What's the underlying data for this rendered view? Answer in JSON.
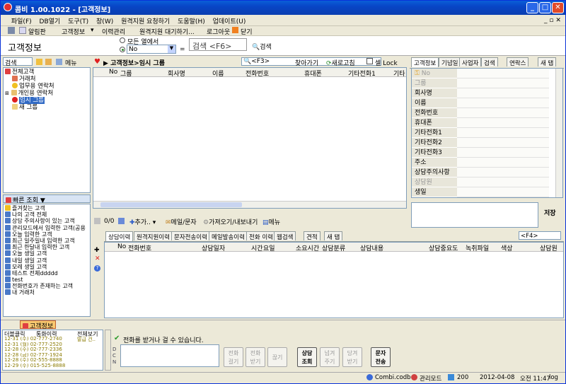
{
  "app": {
    "title": "콤비 1.00.1022 - [고객정보]"
  },
  "menu": [
    "파일(F)",
    "DB열기",
    "도구(T)",
    "창(W)",
    "원격지원 요청하기",
    "도움말(H)",
    "업데이트(U)"
  ],
  "toolbar": {
    "notice": "알림판",
    "customer_info": "고객정보",
    "history": "이력관리",
    "remote_wait": "원격지원 대기하기...",
    "logout": "로그아웃",
    "close": "닫기"
  },
  "header": {
    "title": "고객정보",
    "radio_all": "모든 열에서",
    "radio_no": "No",
    "equals": "=",
    "search_value": "검색 <F6>",
    "search_btn": "검색"
  },
  "left": {
    "search_label": "검색",
    "menu_btn": "메뉴",
    "tree": [
      "전체고객",
      "거래처",
      "업무용 연락처",
      "개인용 연락처",
      "임시 그룹",
      "새 그룹"
    ],
    "quick_title": "빠른 조회 ▼",
    "quick": [
      "즐겨찾는 고객",
      "나의 고객 전체",
      "상담 주의사항이 있는 고객",
      "관리모드에서 입력한 고객(공용",
      "오늘 입력한 고객",
      "최근 일주일내 입력한 고객",
      "최근 한달내 입력한 고객",
      "오늘 생일 고객",
      "내일 생일 고객",
      "모레 생일 고객",
      "테스트 전체ddddd",
      "test",
      "전화번호가 존재하는 고객",
      "내 거래처"
    ]
  },
  "list": {
    "path": "고객정보>임시 그룹",
    "f3": "<F3>",
    "find": "찾아가기",
    "refresh": "새로고침",
    "cell_lock": "셀 Lock",
    "columns": [
      "No",
      "그룹",
      "회사명",
      "이름",
      "전화번호",
      "휴대폰",
      "기타전화1",
      "기타"
    ],
    "count": "0/0",
    "add": "추가..",
    "mail": "메일/문자",
    "import": "가져오기/내보내기",
    "menu": "메뉴"
  },
  "detail": {
    "tabs": [
      "고객정보",
      "기념일",
      "사업자",
      "검색",
      "연락스",
      "새 탭"
    ],
    "fields": [
      "No",
      "그룹",
      "회사명",
      "이름",
      "전화번호",
      "휴대폰",
      "기타전화1",
      "기타전화2",
      "기타전화3",
      "주소",
      "상담주의사항",
      "상담원",
      "생일"
    ],
    "save": "저장"
  },
  "history": {
    "tabs": [
      "상담이력",
      "원격지원이력",
      "문자전송이력",
      "메일발송이력",
      "전화 이력",
      "웹검색",
      "견적",
      "새 탭"
    ],
    "f4": "<F4>",
    "columns": [
      "No",
      "전화번호",
      "상담일자",
      "시간",
      "요일",
      "소요시간",
      "상담분류",
      "상담내용",
      "상담중요도",
      "녹취파일",
      "색상",
      "상담원"
    ]
  },
  "bottom_tab": "고객정보",
  "callpanel": {
    "h1": "더블클릭",
    "h2": "통화이력",
    "h3": "전체보기",
    "status": "전화를 받거나 걸 수 있습니다.",
    "side": [
      "D",
      "C",
      "N"
    ],
    "calls": [
      "12-31 (수) 02-777-2740",
      "12-31 (월) 02-777-2520",
      "12-28 (수) 02-777-2336",
      "12-28 (금) 02-777-1924",
      "12-28 (수) 02-555-8888",
      "12-29 (수) 015-525-8888"
    ],
    "call_extra": "발급 건..",
    "buttons": [
      "전화\n걸기",
      "전화\n받기",
      "끊기",
      "상담\n조회",
      "넘겨\n주기",
      "당겨\n받기",
      "문자\n전송"
    ]
  },
  "status": {
    "db": "Combi.codb",
    "mode": "관리모드",
    "count": "200",
    "date": "2012-04-08",
    "time": "오전 11:47",
    "log": "log"
  }
}
